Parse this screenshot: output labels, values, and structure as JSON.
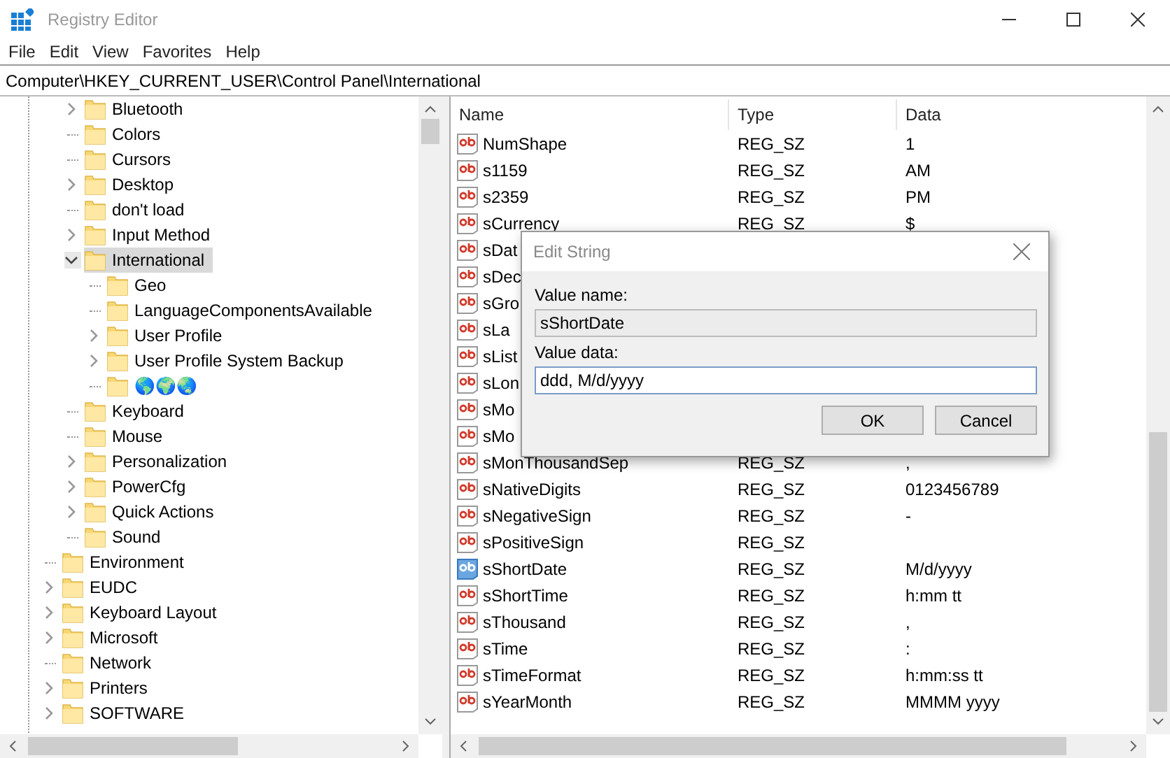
{
  "window": {
    "title": "Registry Editor"
  },
  "menu": [
    "File",
    "Edit",
    "View",
    "Favorites",
    "Help"
  ],
  "address": {
    "path": "Computer\\HKEY_CURRENT_USER\\Control Panel\\International"
  },
  "tree": [
    {
      "children": [
        {
          "label": "Bluetooth",
          "expandable": true,
          "expanded": false,
          "selected": false
        },
        {
          "label": "Colors",
          "expandable": false,
          "selected": false
        },
        {
          "label": "Cursors",
          "expandable": false,
          "selected": false
        },
        {
          "label": "Desktop",
          "expandable": true,
          "expanded": false,
          "selected": false
        },
        {
          "label": "don't load",
          "expandable": false,
          "selected": false
        },
        {
          "label": "Input Method",
          "expandable": true,
          "expanded": false,
          "selected": false
        },
        {
          "label": "International",
          "expandable": true,
          "expanded": true,
          "selected": true,
          "children": [
            {
              "label": "Geo",
              "expandable": false,
              "selected": false
            },
            {
              "label": "LanguageComponentsAvailable",
              "expandable": false,
              "selected": false
            },
            {
              "label": "User Profile",
              "expandable": true,
              "expanded": false,
              "selected": false
            },
            {
              "label": "User Profile System Backup",
              "expandable": true,
              "expanded": false,
              "selected": false
            },
            {
              "label": "🌎🌍🌏",
              "expandable": false,
              "selected": false
            }
          ]
        },
        {
          "label": "Keyboard",
          "expandable": false,
          "selected": false
        },
        {
          "label": "Mouse",
          "expandable": false,
          "selected": false
        },
        {
          "label": "Personalization",
          "expandable": true,
          "expanded": false,
          "selected": false
        },
        {
          "label": "PowerCfg",
          "expandable": true,
          "expanded": false,
          "selected": false
        },
        {
          "label": "Quick Actions",
          "expandable": true,
          "expanded": false,
          "selected": false
        },
        {
          "label": "Sound",
          "expandable": false,
          "selected": false
        }
      ]
    },
    {
      "label": "Environment",
      "expandable": false,
      "selected": false
    },
    {
      "label": "EUDC",
      "expandable": true,
      "expanded": false,
      "selected": false
    },
    {
      "label": "Keyboard Layout",
      "expandable": true,
      "expanded": false,
      "selected": false
    },
    {
      "label": "Microsoft",
      "expandable": true,
      "expanded": false,
      "selected": false
    },
    {
      "label": "Network",
      "expandable": false,
      "selected": false
    },
    {
      "label": "Printers",
      "expandable": true,
      "expanded": false,
      "selected": false
    },
    {
      "label": "SOFTWARE",
      "expandable": true,
      "expanded": false,
      "selected": false
    }
  ],
  "table": {
    "columns": [
      "Name",
      "Type",
      "Data"
    ],
    "rows": [
      {
        "name": "NumShape",
        "type": "REG_SZ",
        "data": "1",
        "selected": false
      },
      {
        "name": "s1159",
        "type": "REG_SZ",
        "data": "AM",
        "selected": false
      },
      {
        "name": "s2359",
        "type": "REG_SZ",
        "data": "PM",
        "selected": false
      },
      {
        "name": "sCurrency",
        "type": "REG_SZ",
        "data": "$",
        "selected": false
      },
      {
        "name": "sDat",
        "selected": false
      },
      {
        "name": "sDec",
        "selected": false
      },
      {
        "name": "sGro",
        "selected": false
      },
      {
        "name": "sLa",
        "selected": false
      },
      {
        "name": "sList",
        "selected": false
      },
      {
        "name": "sLon",
        "selected": false
      },
      {
        "name": "sMo",
        "selected": false
      },
      {
        "name": "sMo",
        "selected": false
      },
      {
        "name": "sMonThousandSep",
        "type": "REG_SZ",
        "data": ",",
        "selected": false
      },
      {
        "name": "sNativeDigits",
        "type": "REG_SZ",
        "data": "0123456789",
        "selected": false
      },
      {
        "name": "sNegativeSign",
        "type": "REG_SZ",
        "data": "-",
        "selected": false
      },
      {
        "name": "sPositiveSign",
        "type": "REG_SZ",
        "selected": false
      },
      {
        "name": "sShortDate",
        "type": "REG_SZ",
        "data": "M/d/yyyy",
        "selected": true
      },
      {
        "name": "sShortTime",
        "type": "REG_SZ",
        "data": "h:mm tt",
        "selected": false
      },
      {
        "name": "sThousand",
        "type": "REG_SZ",
        "data": ",",
        "selected": false
      },
      {
        "name": "sTime",
        "type": "REG_SZ",
        "data": ":",
        "selected": false
      },
      {
        "name": "sTimeFormat",
        "type": "REG_SZ",
        "data": "h:mm:ss tt",
        "selected": false
      },
      {
        "name": "sYearMonth",
        "type": "REG_SZ",
        "data": "MMMM yyyy",
        "selected": false
      }
    ]
  },
  "dialog": {
    "title": "Edit String",
    "name_label": "Value name:",
    "name_value": "sShortDate",
    "data_label": "Value data:",
    "data_value": "ddd, M/d/yyyy",
    "buttons": [
      "OK",
      "Cancel"
    ]
  }
}
